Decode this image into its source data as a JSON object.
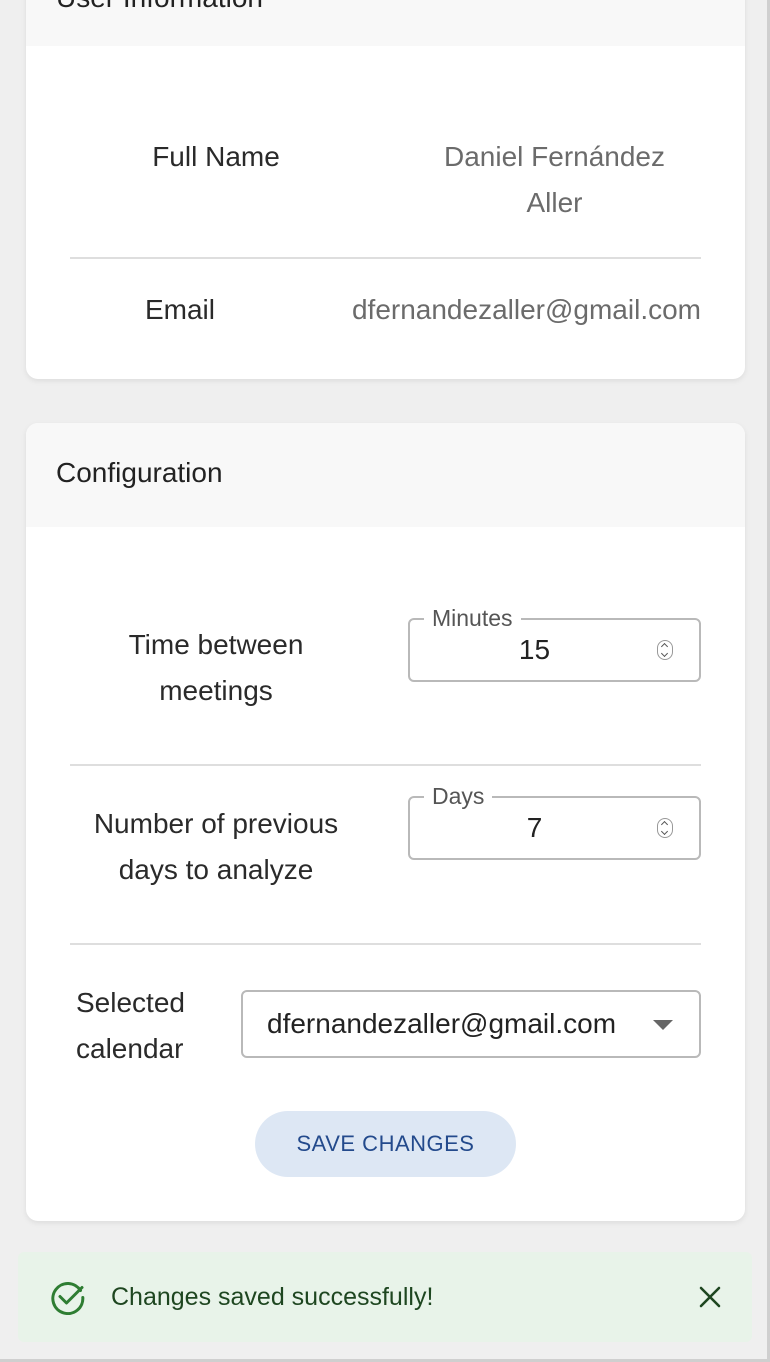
{
  "user_info": {
    "title": "User Information",
    "full_name_label": "Full Name",
    "full_name_value_line1": "Daniel Fernández",
    "full_name_value_line2": "Aller",
    "email_label": "Email",
    "email_value": "dfernandezaller@gmail.com"
  },
  "configuration": {
    "title": "Configuration",
    "time_between_label_line1": "Time between",
    "time_between_label_line2": "meetings",
    "minutes_legend": "Minutes",
    "minutes_value": "15",
    "previous_days_label_line1": "Number of previous",
    "previous_days_label_line2": "days to analyze",
    "days_legend": "Days",
    "days_value": "7",
    "calendar_label_line1": "Selected",
    "calendar_label_line2": "calendar",
    "calendar_value": "dfernandezaller@gmail.com",
    "save_button": "SAVE CHANGES"
  },
  "toast": {
    "message": "Changes saved successfully!",
    "icon": "check-circle-icon",
    "close_icon": "close-icon",
    "color": "#2e7d32"
  }
}
